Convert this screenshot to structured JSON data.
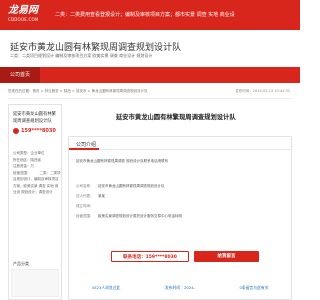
{
  "site": {
    "logo_main": "龙易网",
    "logo_sub": "CDDOOE.COM",
    "top_scope": "二类：二类费用查看登报设计；编制及审核项目方案；都市实景 调查 实地 商业设"
  },
  "company": {
    "title": "延安市黄龙山圆有林繁现周调查规划设计队",
    "desc": "二类：二类项目规划设计 编制及审核项目方案 欧美实景 调查 商业设计 规划设计"
  },
  "nav": {
    "tab_label": "公司首页"
  },
  "breadcrumb": {
    "path": "您现在的位置：首页 > 林业服务 > 陕西 > 延安市 > 黄龙山圆有林繁现周调查规划设计队",
    "time": "发布时间：2024-03-13 10:42:32"
  },
  "sidebar": {
    "company_name": "延安市黄龙山圆有林繁现周调查规划设计队",
    "phone": "159****8030",
    "info": [
      {
        "key": "公司类型：",
        "value": "企业单位"
      },
      {
        "key": "所在地区：",
        "value": "陕西省"
      },
      {
        "key": "注册资金：",
        "value": "万"
      },
      {
        "key": "经营范围：",
        "value": "二类：二类项目规划设计，编制及审核项目方案；欧美实景 调查 实地 商业设 规划设计；调查设计"
      }
    ],
    "products_heading": "产品分类"
  },
  "main": {
    "title": "延安市黄龙山圆有林繁现周调查规划设计队",
    "section_label": "公司介绍",
    "intro": "延安市黄龙山圆有林繁现周调查 规划设计队联系电话请联系",
    "info_rows": [
      {
        "key": "公司名称：",
        "value": "延安市黄龙山圆有林繁现周调查规划设计队"
      },
      {
        "key": "法人代表：",
        "value": "某某"
      },
      {
        "key": "成立时间：",
        "value": ""
      },
      {
        "key": "经营范围：",
        "value": "欧美实景调查规划设计委托设计服务交易中心电话标明"
      }
    ],
    "phone_button": "联系电话：159****8030",
    "contact_button": "给我留言",
    "stats": [
      "4523人浏览过此",
      "发布时间：2024-",
      "0条留言与此有关"
    ]
  },
  "colors": {
    "brand": "#d9261c",
    "brand_dark": "#a81a14"
  }
}
